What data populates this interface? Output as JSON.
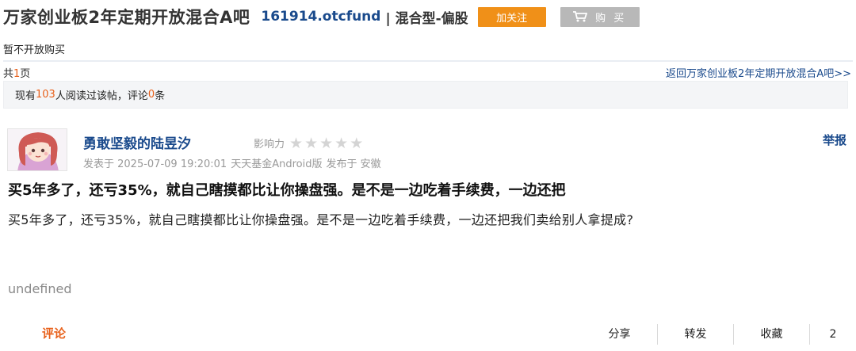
{
  "header": {
    "bar_title": "万家创业板2年定期开放混合A吧",
    "fund_code": "161914.otcfund",
    "fund_type": "| 混合型-偏股",
    "follow_label": "加关注",
    "buy_label": "购 买"
  },
  "notice": "暂不开放购买",
  "pagination": {
    "prefix": "共",
    "pages": "1",
    "suffix": "页",
    "back_link": "返回万家创业板2年定期开放混合A吧>>"
  },
  "read_stats": {
    "prefix": "现有",
    "readers": "103",
    "middle": "人阅读过该帖，评论",
    "comments": "0",
    "suffix": "条"
  },
  "author": {
    "name": "勇敢坚毅的陆昱汐",
    "influence_label": "影响力",
    "influence_stars": 0,
    "report_label": "举报"
  },
  "meta": {
    "posted_at": "发表于 2025-07-09 19:20:01",
    "source": "天天基金Android版",
    "location": "发布于 安徽"
  },
  "post": {
    "title": "买5年多了，还亏35%，就自己瞎摸都比让你操盘强。是不是一边吃着手续费，一边还把",
    "body": "买5年多了，还亏35%，就自己瞎摸都比让你操盘强。是不是一边吃着手续费，一边还把我们卖给别人拿提成?",
    "extra": "undefined"
  },
  "footer": {
    "comment_label": "评论",
    "share_label": "分享",
    "forward_label": "转发",
    "favorite_label": "收藏",
    "like_count": "2"
  },
  "colors": {
    "link_blue": "#1a4a8c",
    "accent_orange": "#e8601a",
    "follow_button": "#f09018",
    "buy_button": "#b8b8b8"
  }
}
